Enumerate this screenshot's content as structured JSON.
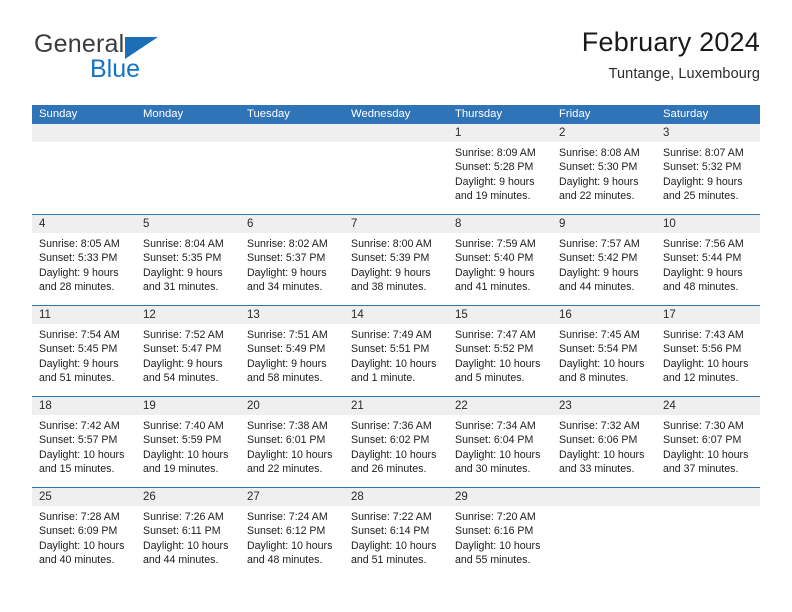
{
  "brand": {
    "name_part1": "General",
    "name_part2": "Blue",
    "flag_icon": "triangle-flag-icon"
  },
  "header": {
    "title": "February 2024",
    "location": "Tuntange, Luxembourg"
  },
  "calendar": {
    "weekday_headers": [
      "Sunday",
      "Monday",
      "Tuesday",
      "Wednesday",
      "Thursday",
      "Friday",
      "Saturday"
    ],
    "colors": {
      "header_blue": "#3074b8",
      "number_band": "#efefef",
      "brand_blue": "#1573c6",
      "text": "#1c1c1c"
    },
    "weeks": [
      {
        "numbers": [
          "",
          "",
          "",
          "",
          "1",
          "2",
          "3"
        ],
        "days": [
          {
            "empty": true,
            "lines": [
              "",
              "",
              "",
              ""
            ]
          },
          {
            "empty": true,
            "lines": [
              "",
              "",
              "",
              ""
            ]
          },
          {
            "empty": true,
            "lines": [
              "",
              "",
              "",
              ""
            ]
          },
          {
            "empty": true,
            "lines": [
              "",
              "",
              "",
              ""
            ]
          },
          {
            "empty": false,
            "lines": [
              "Sunrise: 8:09 AM",
              "Sunset: 5:28 PM",
              "Daylight: 9 hours",
              "and 19 minutes."
            ]
          },
          {
            "empty": false,
            "lines": [
              "Sunrise: 8:08 AM",
              "Sunset: 5:30 PM",
              "Daylight: 9 hours",
              "and 22 minutes."
            ]
          },
          {
            "empty": false,
            "lines": [
              "Sunrise: 8:07 AM",
              "Sunset: 5:32 PM",
              "Daylight: 9 hours",
              "and 25 minutes."
            ]
          }
        ]
      },
      {
        "numbers": [
          "4",
          "5",
          "6",
          "7",
          "8",
          "9",
          "10"
        ],
        "days": [
          {
            "empty": false,
            "lines": [
              "Sunrise: 8:05 AM",
              "Sunset: 5:33 PM",
              "Daylight: 9 hours",
              "and 28 minutes."
            ]
          },
          {
            "empty": false,
            "lines": [
              "Sunrise: 8:04 AM",
              "Sunset: 5:35 PM",
              "Daylight: 9 hours",
              "and 31 minutes."
            ]
          },
          {
            "empty": false,
            "lines": [
              "Sunrise: 8:02 AM",
              "Sunset: 5:37 PM",
              "Daylight: 9 hours",
              "and 34 minutes."
            ]
          },
          {
            "empty": false,
            "lines": [
              "Sunrise: 8:00 AM",
              "Sunset: 5:39 PM",
              "Daylight: 9 hours",
              "and 38 minutes."
            ]
          },
          {
            "empty": false,
            "lines": [
              "Sunrise: 7:59 AM",
              "Sunset: 5:40 PM",
              "Daylight: 9 hours",
              "and 41 minutes."
            ]
          },
          {
            "empty": false,
            "lines": [
              "Sunrise: 7:57 AM",
              "Sunset: 5:42 PM",
              "Daylight: 9 hours",
              "and 44 minutes."
            ]
          },
          {
            "empty": false,
            "lines": [
              "Sunrise: 7:56 AM",
              "Sunset: 5:44 PM",
              "Daylight: 9 hours",
              "and 48 minutes."
            ]
          }
        ]
      },
      {
        "numbers": [
          "11",
          "12",
          "13",
          "14",
          "15",
          "16",
          "17"
        ],
        "days": [
          {
            "empty": false,
            "lines": [
              "Sunrise: 7:54 AM",
              "Sunset: 5:45 PM",
              "Daylight: 9 hours",
              "and 51 minutes."
            ]
          },
          {
            "empty": false,
            "lines": [
              "Sunrise: 7:52 AM",
              "Sunset: 5:47 PM",
              "Daylight: 9 hours",
              "and 54 minutes."
            ]
          },
          {
            "empty": false,
            "lines": [
              "Sunrise: 7:51 AM",
              "Sunset: 5:49 PM",
              "Daylight: 9 hours",
              "and 58 minutes."
            ]
          },
          {
            "empty": false,
            "lines": [
              "Sunrise: 7:49 AM",
              "Sunset: 5:51 PM",
              "Daylight: 10 hours",
              "and 1 minute."
            ]
          },
          {
            "empty": false,
            "lines": [
              "Sunrise: 7:47 AM",
              "Sunset: 5:52 PM",
              "Daylight: 10 hours",
              "and 5 minutes."
            ]
          },
          {
            "empty": false,
            "lines": [
              "Sunrise: 7:45 AM",
              "Sunset: 5:54 PM",
              "Daylight: 10 hours",
              "and 8 minutes."
            ]
          },
          {
            "empty": false,
            "lines": [
              "Sunrise: 7:43 AM",
              "Sunset: 5:56 PM",
              "Daylight: 10 hours",
              "and 12 minutes."
            ]
          }
        ]
      },
      {
        "numbers": [
          "18",
          "19",
          "20",
          "21",
          "22",
          "23",
          "24"
        ],
        "days": [
          {
            "empty": false,
            "lines": [
              "Sunrise: 7:42 AM",
              "Sunset: 5:57 PM",
              "Daylight: 10 hours",
              "and 15 minutes."
            ]
          },
          {
            "empty": false,
            "lines": [
              "Sunrise: 7:40 AM",
              "Sunset: 5:59 PM",
              "Daylight: 10 hours",
              "and 19 minutes."
            ]
          },
          {
            "empty": false,
            "lines": [
              "Sunrise: 7:38 AM",
              "Sunset: 6:01 PM",
              "Daylight: 10 hours",
              "and 22 minutes."
            ]
          },
          {
            "empty": false,
            "lines": [
              "Sunrise: 7:36 AM",
              "Sunset: 6:02 PM",
              "Daylight: 10 hours",
              "and 26 minutes."
            ]
          },
          {
            "empty": false,
            "lines": [
              "Sunrise: 7:34 AM",
              "Sunset: 6:04 PM",
              "Daylight: 10 hours",
              "and 30 minutes."
            ]
          },
          {
            "empty": false,
            "lines": [
              "Sunrise: 7:32 AM",
              "Sunset: 6:06 PM",
              "Daylight: 10 hours",
              "and 33 minutes."
            ]
          },
          {
            "empty": false,
            "lines": [
              "Sunrise: 7:30 AM",
              "Sunset: 6:07 PM",
              "Daylight: 10 hours",
              "and 37 minutes."
            ]
          }
        ]
      },
      {
        "numbers": [
          "25",
          "26",
          "27",
          "28",
          "29",
          "",
          ""
        ],
        "days": [
          {
            "empty": false,
            "lines": [
              "Sunrise: 7:28 AM",
              "Sunset: 6:09 PM",
              "Daylight: 10 hours",
              "and 40 minutes."
            ]
          },
          {
            "empty": false,
            "lines": [
              "Sunrise: 7:26 AM",
              "Sunset: 6:11 PM",
              "Daylight: 10 hours",
              "and 44 minutes."
            ]
          },
          {
            "empty": false,
            "lines": [
              "Sunrise: 7:24 AM",
              "Sunset: 6:12 PM",
              "Daylight: 10 hours",
              "and 48 minutes."
            ]
          },
          {
            "empty": false,
            "lines": [
              "Sunrise: 7:22 AM",
              "Sunset: 6:14 PM",
              "Daylight: 10 hours",
              "and 51 minutes."
            ]
          },
          {
            "empty": false,
            "lines": [
              "Sunrise: 7:20 AM",
              "Sunset: 6:16 PM",
              "Daylight: 10 hours",
              "and 55 minutes."
            ]
          },
          {
            "empty": true,
            "lines": [
              "",
              "",
              "",
              ""
            ]
          },
          {
            "empty": true,
            "lines": [
              "",
              "",
              "",
              ""
            ]
          }
        ]
      }
    ]
  }
}
